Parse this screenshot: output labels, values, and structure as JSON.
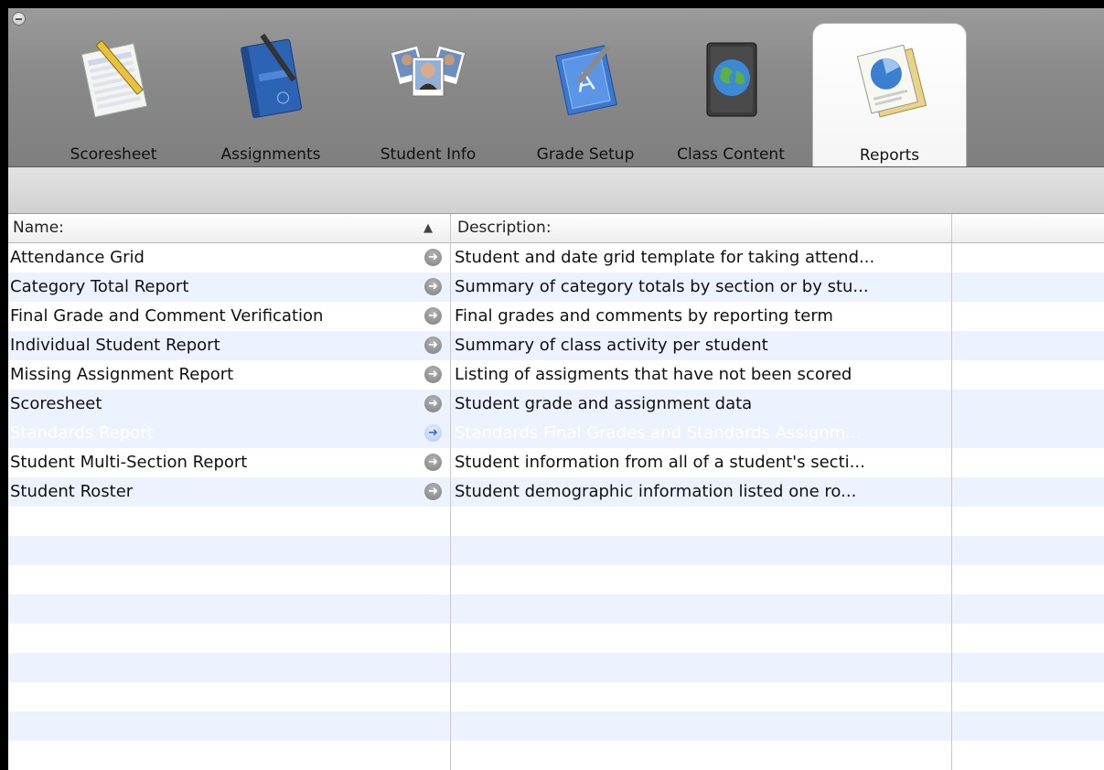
{
  "toolbar": {
    "tabs": [
      {
        "label": "Scoresheet",
        "icon": "scoresheet-icon"
      },
      {
        "label": "Assignments",
        "icon": "assignments-notebook-icon"
      },
      {
        "label": "Student Info",
        "icon": "student-photos-icon"
      },
      {
        "label": "Grade Setup",
        "icon": "grade-setup-icon"
      },
      {
        "label": "Class Content",
        "icon": "class-content-globe-icon"
      },
      {
        "label": "Reports",
        "icon": "reports-pie-chart-icon"
      }
    ],
    "active_tab": "Reports"
  },
  "table": {
    "columns": {
      "name": "Name:",
      "description": "Description:"
    },
    "sort_indicator": "▲",
    "rows": [
      {
        "name": "Attendance Grid",
        "description": "Student and date grid template for taking attend..."
      },
      {
        "name": "Category Total Report",
        "description": "Summary of category totals by section or by stu..."
      },
      {
        "name": "Final Grade and Comment Verification",
        "description": "Final grades and comments by reporting term"
      },
      {
        "name": "Individual Student Report",
        "description": "Summary of class activity per student"
      },
      {
        "name": "Missing Assignment Report",
        "description": "Listing of assigments that have not been scored"
      },
      {
        "name": "Scoresheet",
        "description": "Student grade and assignment data"
      },
      {
        "name": "Standards Report",
        "description": "Standards Final Grades and Standards Assignm..."
      },
      {
        "name": "Student Multi-Section Report",
        "description": "Student information from all of a student's secti..."
      },
      {
        "name": "Student Roster",
        "description": "Student demographic information listed one ro..."
      }
    ],
    "selected_row": "Standards Report",
    "arrow_glyph": "➜"
  },
  "colors": {
    "selection": "#3875d7",
    "alt_row": "#edf3fe",
    "toolbar": "#8a8a8a"
  }
}
